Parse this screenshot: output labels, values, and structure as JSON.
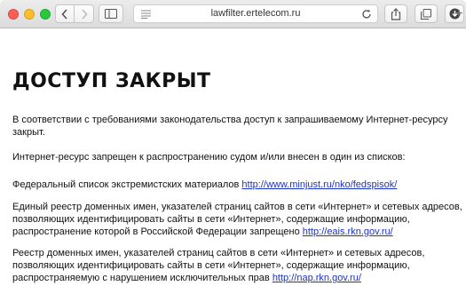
{
  "browser": {
    "url": "lawfilter.ertelecom.ru",
    "new_tab_symbol": "+"
  },
  "icons": [
    "close-icon",
    "minimize-icon",
    "zoom-icon",
    "back-icon",
    "forward-icon",
    "sidebar-icon",
    "reader-icon",
    "reload-icon",
    "share-icon",
    "tabs-icon",
    "download-icon",
    "plus-icon"
  ],
  "page": {
    "title": "ДОСТУП ЗАКРЫТ",
    "intro_line1": "В соответствии с требованиями законодательства доступ к запрашиваемому Интернет-ресурсу",
    "intro_line2": "закрыт.",
    "ban_notice": "Интернет-ресурс запрещен к распространению судом и/или внесен в один из списков:",
    "list1_text": "Федеральный список экстремистских материалов ",
    "list1_link": "http://www.minjust.ru/nko/fedspisok/",
    "list2_line1": "Единый реестр доменных имен, указателей страниц сайтов в сети «Интернет» и сетевых адресов,",
    "list2_line2": "позволяющих идентифицировать сайты в сети «Интернет», содержащие информацию,",
    "list2_line3": "распространение которой в Российской Федерации запрещено ",
    "list2_link": "http://eais.rkn.gov.ru/",
    "list3_line1": "Реестр доменных имен, указателей страниц сайтов в сети «Интернет» и сетевых адресов,",
    "list3_line2": "позволяющих идентифицировать сайты в сети «Интернет», содержащие информацию,",
    "list3_line3": "распространяемую с нарушением исключительных прав ",
    "list3_link": "http://nap.rkn.gov.ru/"
  },
  "colors": {
    "link": "#1a32c8",
    "text": "#111111"
  }
}
